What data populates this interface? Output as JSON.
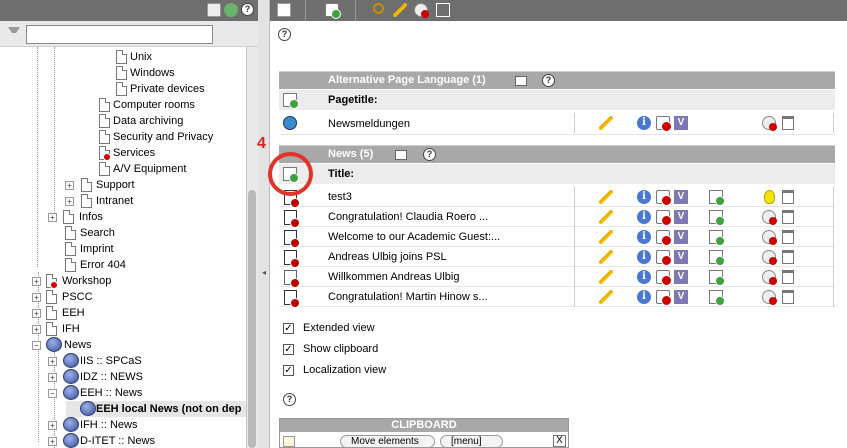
{
  "tree": {
    "filter_value": "",
    "nodes": [
      {
        "label": "Unix"
      },
      {
        "label": "Windows"
      },
      {
        "label": "Private devices"
      },
      {
        "label": "Computer rooms"
      },
      {
        "label": "Data archiving"
      },
      {
        "label": "Security and Privacy"
      },
      {
        "label": "Services"
      },
      {
        "label": "A/V Equipment"
      },
      {
        "label": "Support"
      },
      {
        "label": "Intranet"
      },
      {
        "label": "Infos"
      },
      {
        "label": "Search"
      },
      {
        "label": "Imprint"
      },
      {
        "label": "Error 404"
      },
      {
        "label": "Workshop"
      },
      {
        "label": "PSCC"
      },
      {
        "label": "EEH"
      },
      {
        "label": "IFH"
      },
      {
        "label": "News"
      },
      {
        "label": "IIS :: SPCaS"
      },
      {
        "label": "IDZ :: NEWS"
      },
      {
        "label": "EEH :: News"
      },
      {
        "label": "EEH local News (not on dep"
      },
      {
        "label": "IFH :: News"
      },
      {
        "label": "D-ITET :: News"
      }
    ]
  },
  "sections": {
    "alt_lang": {
      "title": "Alternative Page Language (1)",
      "column": "Pagetitle:",
      "rows": [
        "Newsmeldungen"
      ]
    },
    "news": {
      "title": "News (5)",
      "column": "Title:",
      "rows": [
        "test3",
        "Congratulation! Claudia Roero ...",
        "Welcome to our Academic Guest:...",
        "Andreas Ulbig joins PSL",
        "Willkommen Andreas Ulbig",
        "Congratulation! Martin Hinow s..."
      ]
    }
  },
  "options": {
    "extended_view": "Extended view",
    "show_clipboard": "Show clipboard",
    "localization_view": "Localization view"
  },
  "clipboard": {
    "title": "CLIPBOARD",
    "mode_select": "Move elements",
    "menu_select": "[menu]",
    "close": "X"
  },
  "annotation": {
    "number": "4"
  },
  "icons": {
    "help": "?",
    "info": "i",
    "version": "V",
    "splitter": "◂"
  },
  "colors": {
    "toolbar": "#6e6e6e",
    "section_header": "#a8a8a8",
    "annotation": "#e02020"
  }
}
